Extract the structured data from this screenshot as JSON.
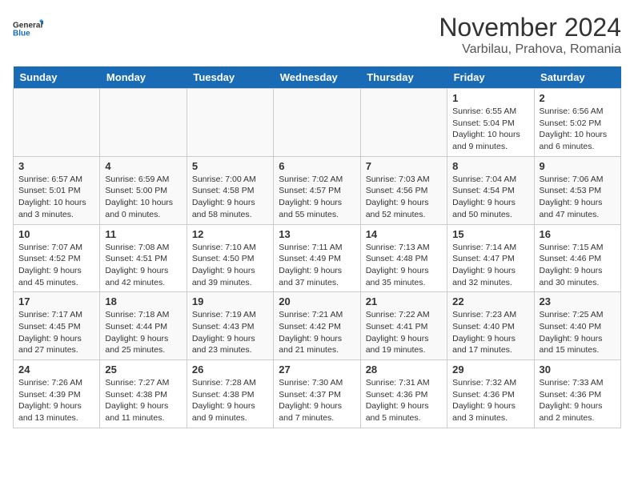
{
  "logo": {
    "general": "General",
    "blue": "Blue"
  },
  "header": {
    "month": "November 2024",
    "location": "Varbilau, Prahova, Romania"
  },
  "weekdays": [
    "Sunday",
    "Monday",
    "Tuesday",
    "Wednesday",
    "Thursday",
    "Friday",
    "Saturday"
  ],
  "weeks": [
    [
      {
        "day": "",
        "info": ""
      },
      {
        "day": "",
        "info": ""
      },
      {
        "day": "",
        "info": ""
      },
      {
        "day": "",
        "info": ""
      },
      {
        "day": "",
        "info": ""
      },
      {
        "day": "1",
        "info": "Sunrise: 6:55 AM\nSunset: 5:04 PM\nDaylight: 10 hours and 9 minutes."
      },
      {
        "day": "2",
        "info": "Sunrise: 6:56 AM\nSunset: 5:02 PM\nDaylight: 10 hours and 6 minutes."
      }
    ],
    [
      {
        "day": "3",
        "info": "Sunrise: 6:57 AM\nSunset: 5:01 PM\nDaylight: 10 hours and 3 minutes."
      },
      {
        "day": "4",
        "info": "Sunrise: 6:59 AM\nSunset: 5:00 PM\nDaylight: 10 hours and 0 minutes."
      },
      {
        "day": "5",
        "info": "Sunrise: 7:00 AM\nSunset: 4:58 PM\nDaylight: 9 hours and 58 minutes."
      },
      {
        "day": "6",
        "info": "Sunrise: 7:02 AM\nSunset: 4:57 PM\nDaylight: 9 hours and 55 minutes."
      },
      {
        "day": "7",
        "info": "Sunrise: 7:03 AM\nSunset: 4:56 PM\nDaylight: 9 hours and 52 minutes."
      },
      {
        "day": "8",
        "info": "Sunrise: 7:04 AM\nSunset: 4:54 PM\nDaylight: 9 hours and 50 minutes."
      },
      {
        "day": "9",
        "info": "Sunrise: 7:06 AM\nSunset: 4:53 PM\nDaylight: 9 hours and 47 minutes."
      }
    ],
    [
      {
        "day": "10",
        "info": "Sunrise: 7:07 AM\nSunset: 4:52 PM\nDaylight: 9 hours and 45 minutes."
      },
      {
        "day": "11",
        "info": "Sunrise: 7:08 AM\nSunset: 4:51 PM\nDaylight: 9 hours and 42 minutes."
      },
      {
        "day": "12",
        "info": "Sunrise: 7:10 AM\nSunset: 4:50 PM\nDaylight: 9 hours and 39 minutes."
      },
      {
        "day": "13",
        "info": "Sunrise: 7:11 AM\nSunset: 4:49 PM\nDaylight: 9 hours and 37 minutes."
      },
      {
        "day": "14",
        "info": "Sunrise: 7:13 AM\nSunset: 4:48 PM\nDaylight: 9 hours and 35 minutes."
      },
      {
        "day": "15",
        "info": "Sunrise: 7:14 AM\nSunset: 4:47 PM\nDaylight: 9 hours and 32 minutes."
      },
      {
        "day": "16",
        "info": "Sunrise: 7:15 AM\nSunset: 4:46 PM\nDaylight: 9 hours and 30 minutes."
      }
    ],
    [
      {
        "day": "17",
        "info": "Sunrise: 7:17 AM\nSunset: 4:45 PM\nDaylight: 9 hours and 27 minutes."
      },
      {
        "day": "18",
        "info": "Sunrise: 7:18 AM\nSunset: 4:44 PM\nDaylight: 9 hours and 25 minutes."
      },
      {
        "day": "19",
        "info": "Sunrise: 7:19 AM\nSunset: 4:43 PM\nDaylight: 9 hours and 23 minutes."
      },
      {
        "day": "20",
        "info": "Sunrise: 7:21 AM\nSunset: 4:42 PM\nDaylight: 9 hours and 21 minutes."
      },
      {
        "day": "21",
        "info": "Sunrise: 7:22 AM\nSunset: 4:41 PM\nDaylight: 9 hours and 19 minutes."
      },
      {
        "day": "22",
        "info": "Sunrise: 7:23 AM\nSunset: 4:40 PM\nDaylight: 9 hours and 17 minutes."
      },
      {
        "day": "23",
        "info": "Sunrise: 7:25 AM\nSunset: 4:40 PM\nDaylight: 9 hours and 15 minutes."
      }
    ],
    [
      {
        "day": "24",
        "info": "Sunrise: 7:26 AM\nSunset: 4:39 PM\nDaylight: 9 hours and 13 minutes."
      },
      {
        "day": "25",
        "info": "Sunrise: 7:27 AM\nSunset: 4:38 PM\nDaylight: 9 hours and 11 minutes."
      },
      {
        "day": "26",
        "info": "Sunrise: 7:28 AM\nSunset: 4:38 PM\nDaylight: 9 hours and 9 minutes."
      },
      {
        "day": "27",
        "info": "Sunrise: 7:30 AM\nSunset: 4:37 PM\nDaylight: 9 hours and 7 minutes."
      },
      {
        "day": "28",
        "info": "Sunrise: 7:31 AM\nSunset: 4:36 PM\nDaylight: 9 hours and 5 minutes."
      },
      {
        "day": "29",
        "info": "Sunrise: 7:32 AM\nSunset: 4:36 PM\nDaylight: 9 hours and 3 minutes."
      },
      {
        "day": "30",
        "info": "Sunrise: 7:33 AM\nSunset: 4:36 PM\nDaylight: 9 hours and 2 minutes."
      }
    ]
  ]
}
